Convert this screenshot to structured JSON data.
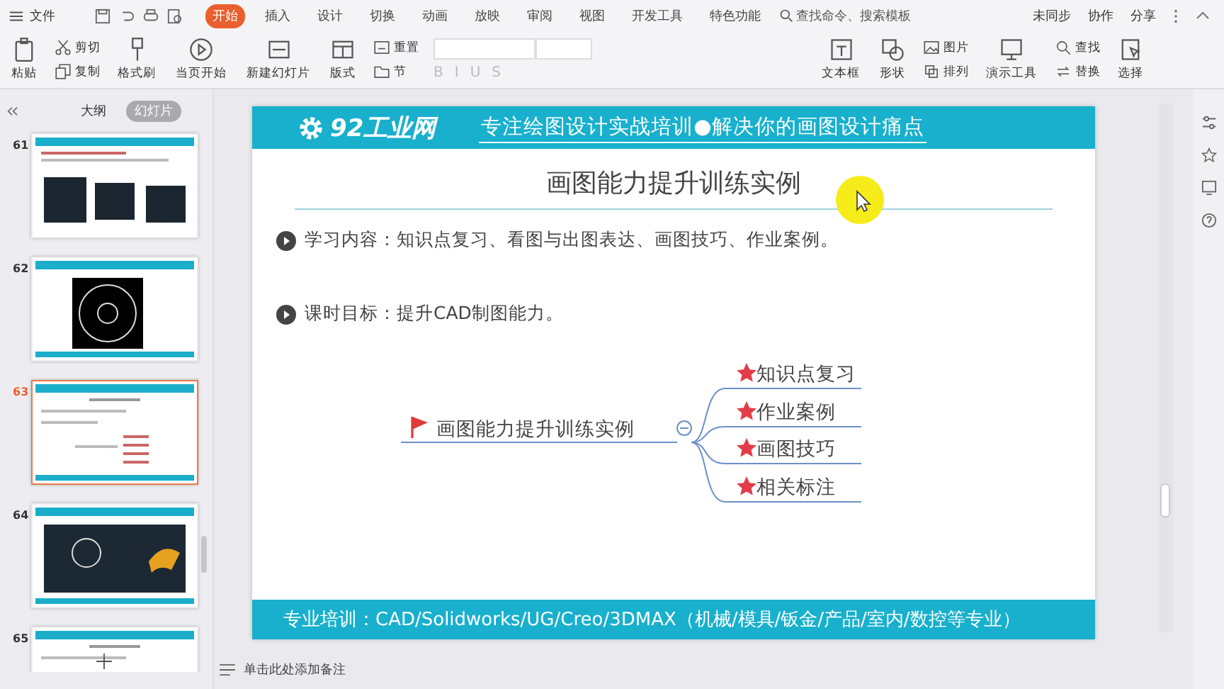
{
  "menu": {
    "file": "文件",
    "tabs": [
      {
        "label": "开始",
        "selected": true
      },
      {
        "label": "插入",
        "selected": false
      },
      {
        "label": "设计",
        "selected": false
      },
      {
        "label": "切换",
        "selected": false
      },
      {
        "label": "动画",
        "selected": false
      },
      {
        "label": "放映",
        "selected": false
      },
      {
        "label": "审阅",
        "selected": false
      },
      {
        "label": "视图",
        "selected": false
      },
      {
        "label": "开发工具",
        "selected": false
      },
      {
        "label": "特色功能",
        "selected": false
      }
    ],
    "search": {
      "placeholder": "查找命令、搜索模板"
    },
    "actions": [
      "未同步",
      "协作",
      "分享"
    ]
  },
  "ribbon": [
    {
      "kind": "large",
      "label": "粘贴"
    },
    {
      "kind": "stack",
      "items": [
        {
          "label": "剪切"
        },
        {
          "label": "复制"
        }
      ]
    },
    {
      "kind": "large",
      "label": "格式刷"
    },
    {
      "kind": "large",
      "label": "当页开始"
    },
    {
      "kind": "large",
      "label": "新建幻灯片"
    },
    {
      "kind": "large",
      "label": "版式"
    },
    {
      "kind": "stack",
      "items": [
        {
          "label": "重置"
        },
        {
          "label": "节"
        }
      ]
    },
    {
      "kind": "font",
      "buttons": [
        {
          "label": "B",
          "disabled": true
        },
        {
          "label": "I",
          "disabled": true
        },
        {
          "label": "U",
          "disabled": true
        },
        {
          "label": "S",
          "disabled": true
        }
      ]
    },
    {
      "kind": "large",
      "label": "文本框"
    },
    {
      "kind": "large",
      "label": "形状"
    },
    {
      "kind": "stack",
      "items": [
        {
          "label": "图片"
        },
        {
          "label": "排列"
        }
      ]
    },
    {
      "kind": "large",
      "label": "演示工具"
    },
    {
      "kind": "stack",
      "items": [
        {
          "label": "查找"
        },
        {
          "label": "替换"
        }
      ]
    },
    {
      "kind": "large",
      "label": "选择"
    }
  ],
  "panel": {
    "tabs": [
      {
        "label": "大纲",
        "selected": false
      },
      {
        "label": "幻灯片",
        "selected": true
      }
    ],
    "slides": [
      {
        "number": "61",
        "selected": false,
        "kind": "three-images"
      },
      {
        "number": "62",
        "selected": false,
        "kind": "one-image"
      },
      {
        "number": "63",
        "selected": true,
        "kind": "mindmap"
      },
      {
        "number": "64",
        "selected": false,
        "kind": "wide-image"
      },
      {
        "number": "65",
        "selected": false,
        "kind": "text"
      }
    ]
  },
  "slide": {
    "logo": "92工业网",
    "tagline": "专注绘图设计实战培训●解决你的画图设计痛点",
    "title": "画图能力提升训练实例",
    "bullets": [
      "学习内容：知识点复习、看图与出图表达、画图技巧、作业案例。",
      "课时目标：提升CAD制图能力。"
    ],
    "mindmap": {
      "root": "画图能力提升训练实例",
      "expanded": true,
      "children": [
        {
          "label": "知识点复习"
        },
        {
          "label": "作业案例"
        },
        {
          "label": "画图技巧"
        },
        {
          "label": "相关标注"
        }
      ]
    },
    "footer": "专业培训：CAD/Solidworks/UG/Creo/3DMAX（机械/模具/钣金/产品/室内/数控等专业）"
  },
  "notes": {
    "placeholder": "单击此处添加备注"
  }
}
